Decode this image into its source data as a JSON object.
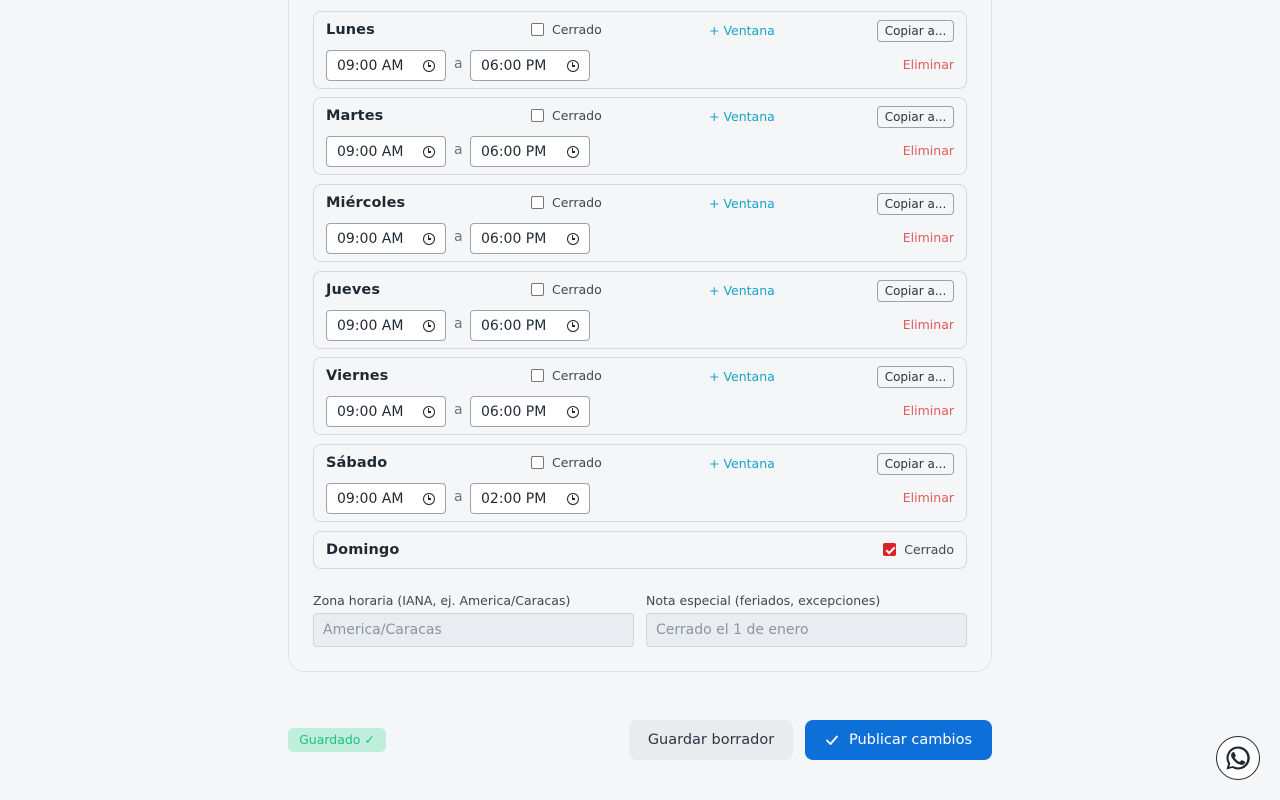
{
  "days": [
    {
      "name": "Lunes",
      "closed_label": "Cerrado",
      "add_window": "+ Ventana",
      "copy": "Copiar a...",
      "start": "09:00 AM",
      "sep": "a",
      "end": "06:00 PM",
      "delete": "Eliminar"
    },
    {
      "name": "Martes",
      "closed_label": "Cerrado",
      "add_window": "+ Ventana",
      "copy": "Copiar a...",
      "start": "09:00 AM",
      "sep": "a",
      "end": "06:00 PM",
      "delete": "Eliminar"
    },
    {
      "name": "Miércoles",
      "closed_label": "Cerrado",
      "add_window": "+ Ventana",
      "copy": "Copiar a...",
      "start": "09:00 AM",
      "sep": "a",
      "end": "06:00 PM",
      "delete": "Eliminar"
    },
    {
      "name": "Jueves",
      "closed_label": "Cerrado",
      "add_window": "+ Ventana",
      "copy": "Copiar a...",
      "start": "09:00 AM",
      "sep": "a",
      "end": "06:00 PM",
      "delete": "Eliminar"
    },
    {
      "name": "Viernes",
      "closed_label": "Cerrado",
      "add_window": "+ Ventana",
      "copy": "Copiar a...",
      "start": "09:00 AM",
      "sep": "a",
      "end": "06:00 PM",
      "delete": "Eliminar"
    },
    {
      "name": "Sábado",
      "closed_label": "Cerrado",
      "add_window": "+ Ventana",
      "copy": "Copiar a...",
      "start": "09:00 AM",
      "sep": "a",
      "end": "02:00 PM",
      "delete": "Eliminar"
    },
    {
      "name": "Domingo",
      "closed_label": "Cerrado",
      "closed": true
    }
  ],
  "timezone": {
    "label": "Zona horaria (IANA, ej. America/Caracas)",
    "placeholder": "America/Caracas"
  },
  "note": {
    "label": "Nota especial (feriados, excepciones)",
    "placeholder": "Cerrado el 1 de enero"
  },
  "footer": {
    "saved_badge": "Guardado ✓",
    "draft_button": "Guardar borrador",
    "publish_button": "Publicar cambios"
  },
  "colors": {
    "accent": "#0d6fd8",
    "link": "#1aa3c8",
    "danger": "#e25b5b",
    "success": "#1fbf85"
  },
  "icons": {
    "clock": "clock-icon",
    "check": "check-icon",
    "whatsapp": "whatsapp-icon"
  }
}
